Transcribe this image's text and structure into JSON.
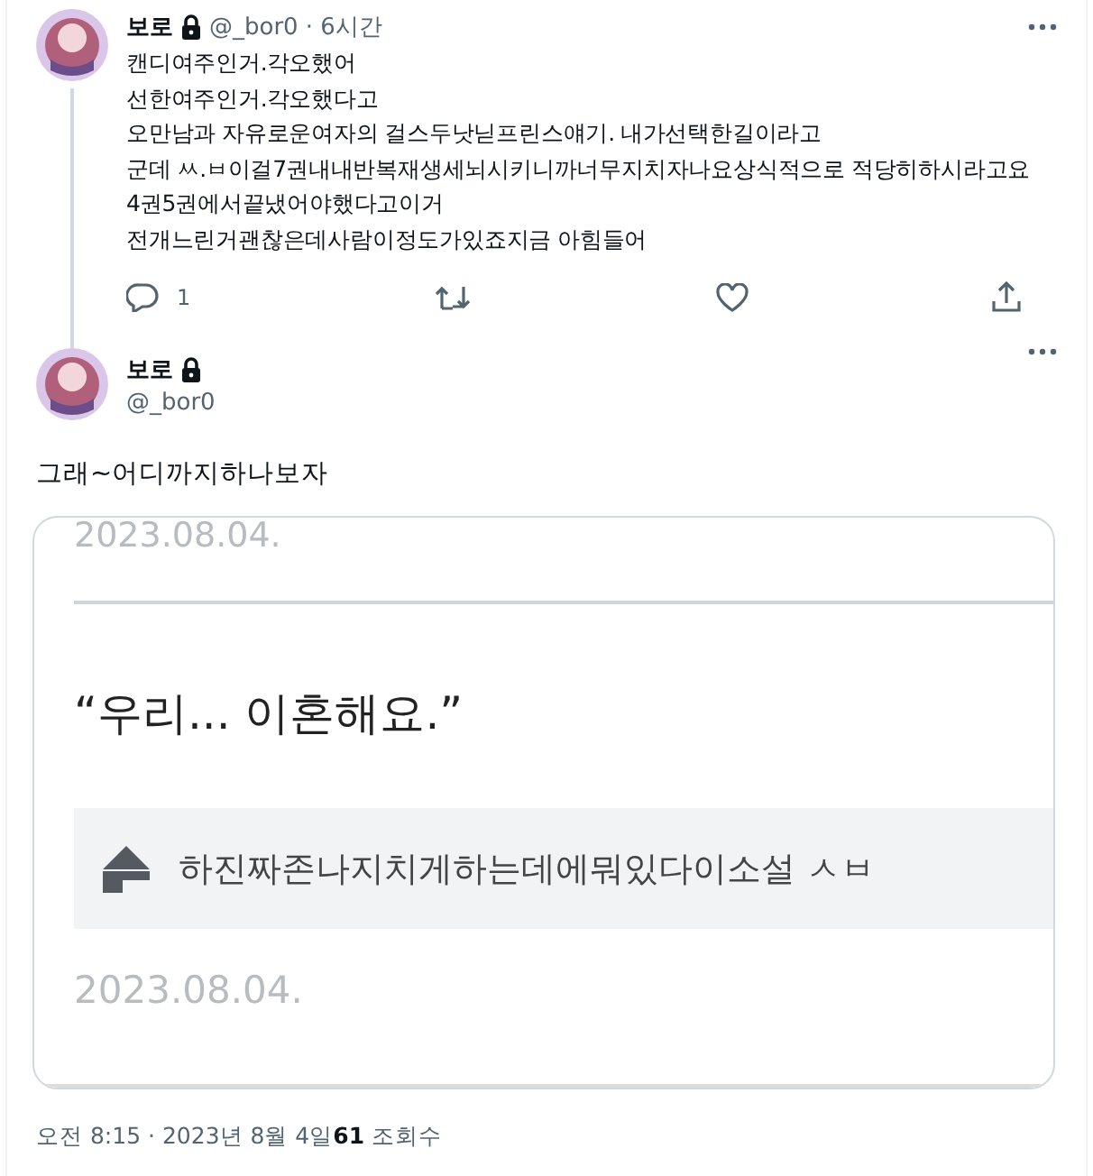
{
  "reply_tweet": {
    "name": "보로",
    "handle": "@_bor0",
    "time": "· 6시간",
    "lines": [
      "캔디여주인거.각오했어",
      "선한여주인거.각오했다고",
      "오만남과 자유로운여자의 걸스두낫닏프린스얘기. 내가선택한길이라고",
      "군데 ㅆ.ㅂ이걸7권내내반복재생세뇌시키니까너무지치자나요상식적으로 적당히하시라고요",
      "4권5권에서끝냈어야했다고이거",
      "전개느린거괜찮은데사람이정도가있죠지금 아힘들어"
    ],
    "reply_count": "1"
  },
  "main_tweet": {
    "name": "보로",
    "handle": "@_bor0",
    "text": "그래~어디까지하나보자",
    "card": {
      "header_date": "2023.08.04.",
      "quote": "“우리... 이혼해요.”",
      "book_title": "하진짜존나지치게하는데에뭐있다이소설 ㅅㅂ",
      "date": "2023.08.04."
    }
  },
  "footer": {
    "time": "오전 8:15 · 2023년 8월 4일",
    "views_count": "61",
    "views_label": "조회수"
  }
}
